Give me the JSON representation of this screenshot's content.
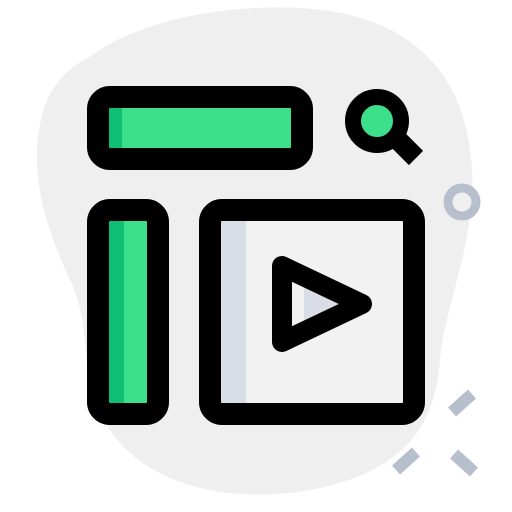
{
  "icon": {
    "name": "video-search-layout-icon",
    "colors": {
      "blob": "#efefef",
      "outline": "#000000",
      "green": "#3ce08a",
      "green_dark": "#0fbf74",
      "panel": "#f2f2f2",
      "panel_shadow": "#d9dde6",
      "play_fill": "#f2f2f2",
      "play_shadow": "#d9dde6",
      "decor": "#b8bfcc"
    },
    "parts": [
      "background-blob",
      "search-bar",
      "search-icon",
      "sidebar",
      "video-panel",
      "play-icon",
      "decorative-circle",
      "decorative-dashes"
    ]
  }
}
